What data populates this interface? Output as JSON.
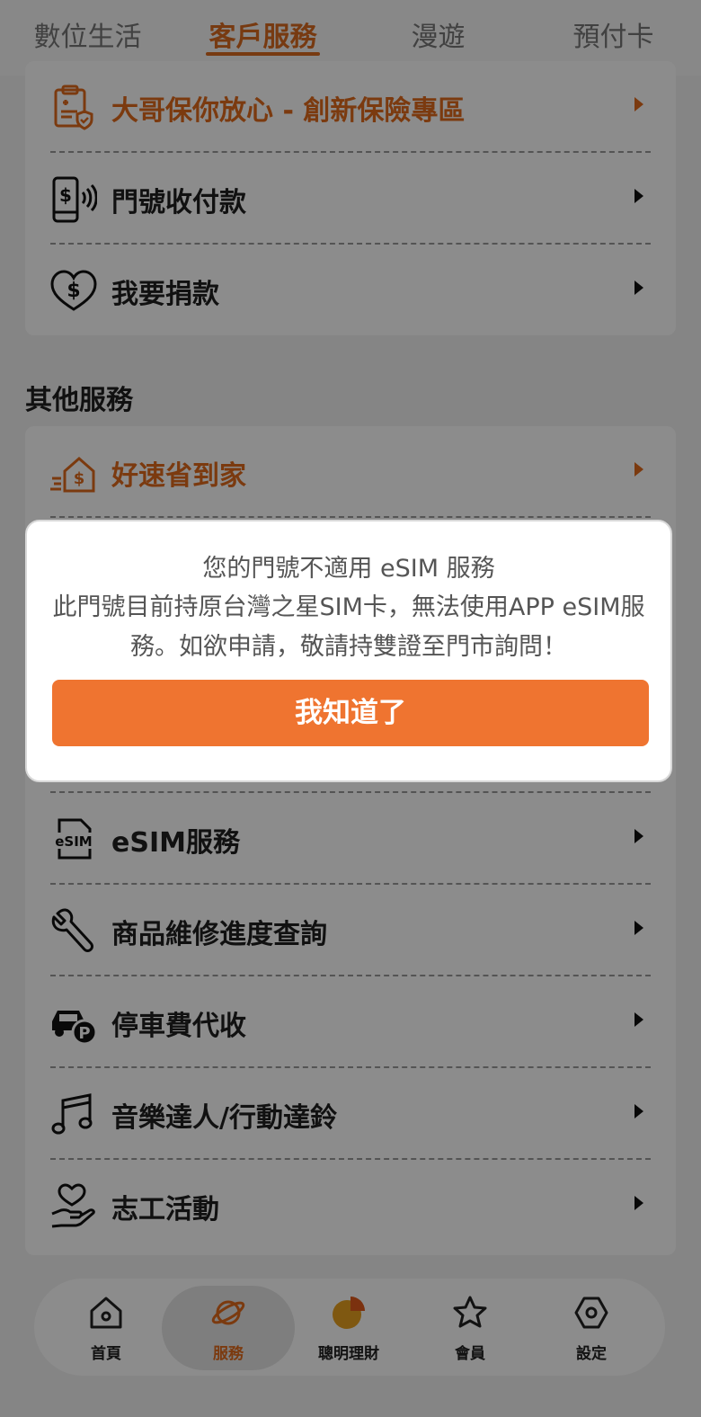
{
  "top_tabs": [
    {
      "label": "數位生活",
      "active": false
    },
    {
      "label": "客戶服務",
      "active": true
    },
    {
      "label": "漫遊",
      "active": false
    },
    {
      "label": "預付卡",
      "active": false
    }
  ],
  "card1": {
    "items": [
      {
        "label": "大哥保你放心 - 創新保險專區",
        "icon": "insurance-doc-icon",
        "highlight": true
      },
      {
        "label": "門號收付款",
        "icon": "phone-payment-icon",
        "highlight": false
      },
      {
        "label": "我要捐款",
        "icon": "heart-dollar-icon",
        "highlight": false
      }
    ]
  },
  "other_services": {
    "title": "其他服務",
    "items": [
      {
        "label": "好速省到家",
        "icon": "home-delivery-icon",
        "highlight": true
      },
      {
        "label": "eSIM服務",
        "icon": "esim-icon",
        "highlight": false
      },
      {
        "label": "商品維修進度查詢",
        "icon": "wrench-icon",
        "highlight": false
      },
      {
        "label": "停車費代收",
        "icon": "car-parking-icon",
        "highlight": false
      },
      {
        "label": "音樂達人/行動達鈴",
        "icon": "music-note-icon",
        "highlight": false
      },
      {
        "label": "志工活動",
        "icon": "volunteer-hand-heart-icon",
        "highlight": false
      }
    ]
  },
  "bottom_nav": [
    {
      "label": "首頁",
      "icon": "home-icon"
    },
    {
      "label": "服務",
      "icon": "planet-icon",
      "active": true
    },
    {
      "label": "聰明理財",
      "icon": "pie-chart-icon"
    },
    {
      "label": "會員",
      "icon": "star-icon"
    },
    {
      "label": "設定",
      "icon": "settings-hex-icon"
    }
  ],
  "dialog": {
    "title": "您的門號不適用 eSIM 服務",
    "message": "此門號目前持原台灣之星SIM卡，無法使用APP eSIM服務。如欲申請，敬請持雙證至門市詢問！",
    "button": "我知道了"
  },
  "colors": {
    "accent": "#e06a1c",
    "button": "#ef7430"
  }
}
